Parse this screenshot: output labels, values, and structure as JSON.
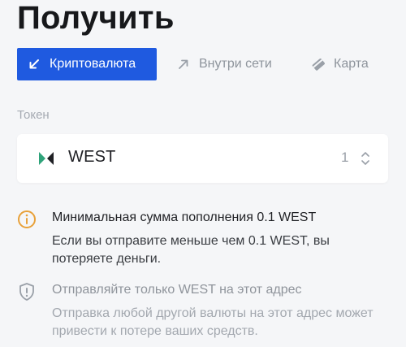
{
  "page": {
    "title": "Получить"
  },
  "tabs": [
    {
      "label": "Криптовалюта",
      "icon": "arrow-down-left-icon",
      "active": true
    },
    {
      "label": "Внутри сети",
      "icon": "arrow-up-right-icon",
      "active": false
    },
    {
      "label": "Карта",
      "icon": "card-icon",
      "active": false
    }
  ],
  "token": {
    "label": "Токен",
    "selected": "WEST",
    "count": "1",
    "icon": "west-logo-icon"
  },
  "notices": [
    {
      "icon": "info-circle-icon",
      "title": "Минимальная сумма пополнения 0.1 WEST",
      "text": "Если вы отправите меньше чем 0.1 WEST, вы потеряете деньги.",
      "color": "#e8a13a"
    },
    {
      "icon": "shield-warning-icon",
      "title": "Отправляйте только WEST на этот адрес",
      "text": "Отправка любой другой валюты на этот адрес может привести к потере ваших средств.",
      "color": "#9aa0a8"
    }
  ],
  "colors": {
    "accent": "#1f5ae0",
    "background": "#f5f6f8",
    "logo_green": "#2fa37a"
  }
}
